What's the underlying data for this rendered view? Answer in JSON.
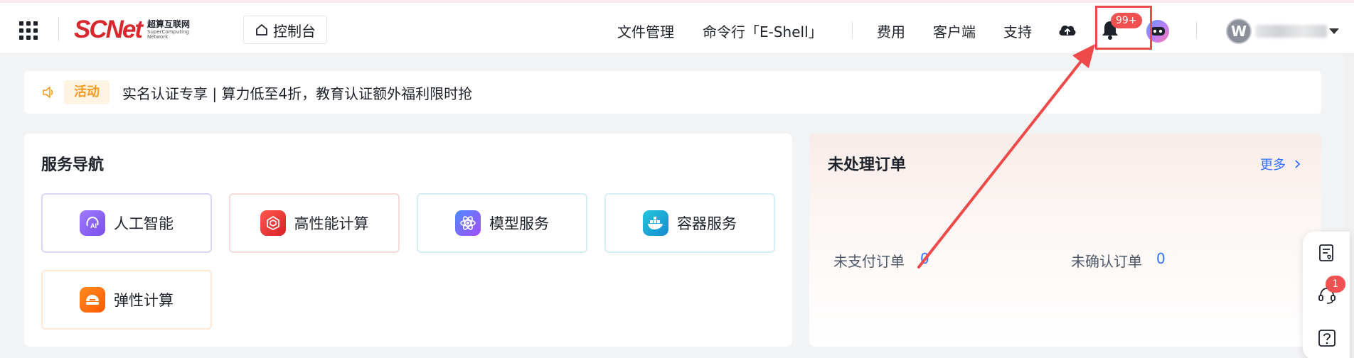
{
  "header": {
    "logo": {
      "word": "SCNet",
      "cn": "超算互联网",
      "en": "SuperComputing Network"
    },
    "console_label": "控制台",
    "nav": [
      "文件管理",
      "命令行「E-Shell」",
      "费用",
      "客户端",
      "支持"
    ],
    "notification_count": "99+",
    "user_initial": "W"
  },
  "announcement": {
    "tag": "活动",
    "message": "实名认证专享 | 算力低至4折，教育认证额外福利限时抢"
  },
  "services": {
    "title": "服务导航",
    "items": [
      {
        "label": "人工智能",
        "icon": "ai-icon",
        "color": "#8a5cf6"
      },
      {
        "label": "高性能计算",
        "icon": "hpc-icon",
        "color": "#e53935"
      },
      {
        "label": "模型服务",
        "icon": "model-icon",
        "color": "#7c4dff"
      },
      {
        "label": "容器服务",
        "icon": "container-icon",
        "color": "#1eaad6"
      },
      {
        "label": "弹性计算",
        "icon": "elastic-icon",
        "color": "#ff6a00"
      }
    ]
  },
  "orders": {
    "title": "未处理订单",
    "more_label": "更多",
    "unpaid_label": "未支付订单",
    "unpaid_value": "0",
    "unconfirmed_label": "未确认订单",
    "unconfirmed_value": "0"
  },
  "float_bar": {
    "support_badge": "1"
  },
  "colors": {
    "brand_red": "#d7282f",
    "link_blue": "#3370ff",
    "annotation_red": "#ef4a4a",
    "activity_orange": "#f59a23"
  }
}
